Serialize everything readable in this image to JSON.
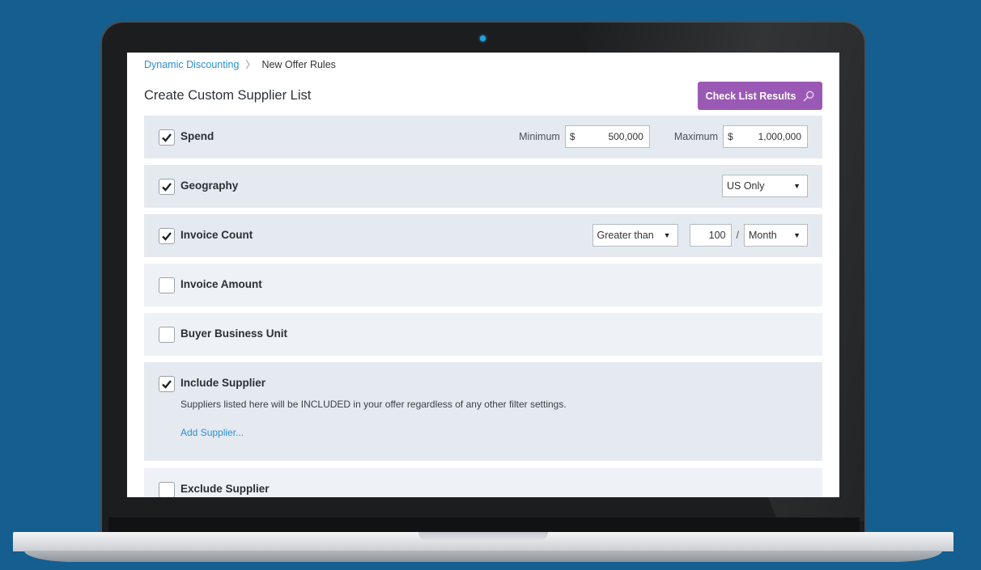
{
  "breadcrumb": {
    "parent": "Dynamic Discounting",
    "separator": "〉",
    "current": "New Offer Rules"
  },
  "page": {
    "title": "Create Custom Supplier List",
    "check_button_label": "Check List Results"
  },
  "filters": {
    "spend": {
      "label": "Spend",
      "checked": true,
      "min_label": "Minimum",
      "max_label": "Maximum",
      "currency": "$",
      "min_value": "500,000",
      "max_value": "1,000,000"
    },
    "geography": {
      "label": "Geography",
      "checked": true,
      "selected": "US Only"
    },
    "invoice_count": {
      "label": "Invoice Count",
      "checked": true,
      "comparator": "Greater than",
      "value": "100",
      "divider": "/",
      "period": "Month"
    },
    "invoice_amount": {
      "label": "Invoice Amount",
      "checked": false
    },
    "buyer_business_unit": {
      "label": "Buyer Business Unit",
      "checked": false
    },
    "include_supplier": {
      "label": "Include Supplier",
      "checked": true,
      "description": "Suppliers listed here will be INCLUDED in your offer regardless of any other filter settings.",
      "add_link": "Add Supplier..."
    },
    "exclude_supplier": {
      "label": "Exclude Supplier",
      "checked": false
    }
  },
  "colors": {
    "background": "#145f8f",
    "accent_button": "#9b59b6",
    "link": "#2a8fd0",
    "row_checked": "#e5eaf1",
    "row_unchecked": "#eef1f6"
  },
  "icons": {
    "check_button": "search-icon",
    "checkbox": "checkmark-icon",
    "dropdown": "caret-down-icon"
  }
}
